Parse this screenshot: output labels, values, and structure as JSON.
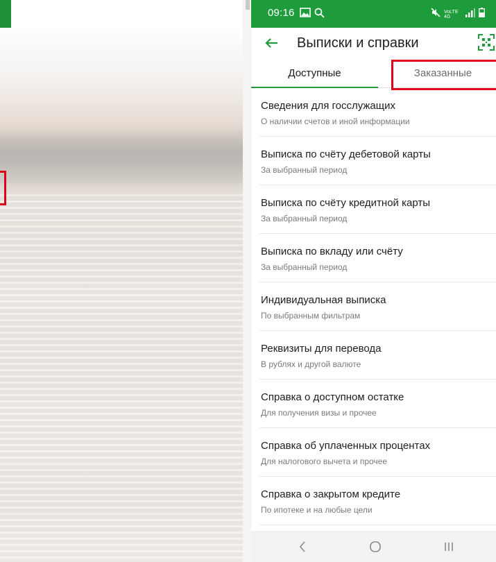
{
  "status_bar": {
    "time": "09:16",
    "icons": [
      "image-icon",
      "search-icon",
      "mute-icon",
      "volte-icon",
      "4g-icon",
      "signal-icon",
      "battery-icon"
    ],
    "network_text": "VoLTE 4G"
  },
  "header": {
    "title": "Выписки и справки",
    "back_icon": "arrow-left-icon",
    "qr_icon": "qr-scan-icon"
  },
  "tabs": [
    {
      "label": "Доступные",
      "active": true
    },
    {
      "label": "Заказанные",
      "active": false,
      "highlighted": true
    }
  ],
  "items": [
    {
      "title": "Сведения для госслужащих",
      "subtitle": "О наличии счетов и иной информации"
    },
    {
      "title": "Выписка по счёту дебетовой карты",
      "subtitle": "За выбранный период"
    },
    {
      "title": "Выписка по счёту кредитной карты",
      "subtitle": "За выбранный период"
    },
    {
      "title": "Выписка по вкладу или счёту",
      "subtitle": "За выбранный период"
    },
    {
      "title": "Индивидуальная выписка",
      "subtitle": "По выбранным фильтрам"
    },
    {
      "title": "Реквизиты для перевода",
      "subtitle": "В рублях и другой валюте"
    },
    {
      "title": "Справка о доступном остатке",
      "subtitle": "Для получения визы и прочее"
    },
    {
      "title": "Справка об уплаченных процентах",
      "subtitle": "Для налогового вычета и прочее"
    },
    {
      "title": "Справка о закрытом кредите",
      "subtitle": "По ипотеке и на любые цели"
    }
  ],
  "nav": {
    "back_icon": "chevron-left-icon",
    "home_icon": "home-circle-icon",
    "recents_icon": "recents-icon"
  },
  "colors": {
    "brand_green": "#1e9b3a",
    "highlight_red": "#e0001b"
  }
}
